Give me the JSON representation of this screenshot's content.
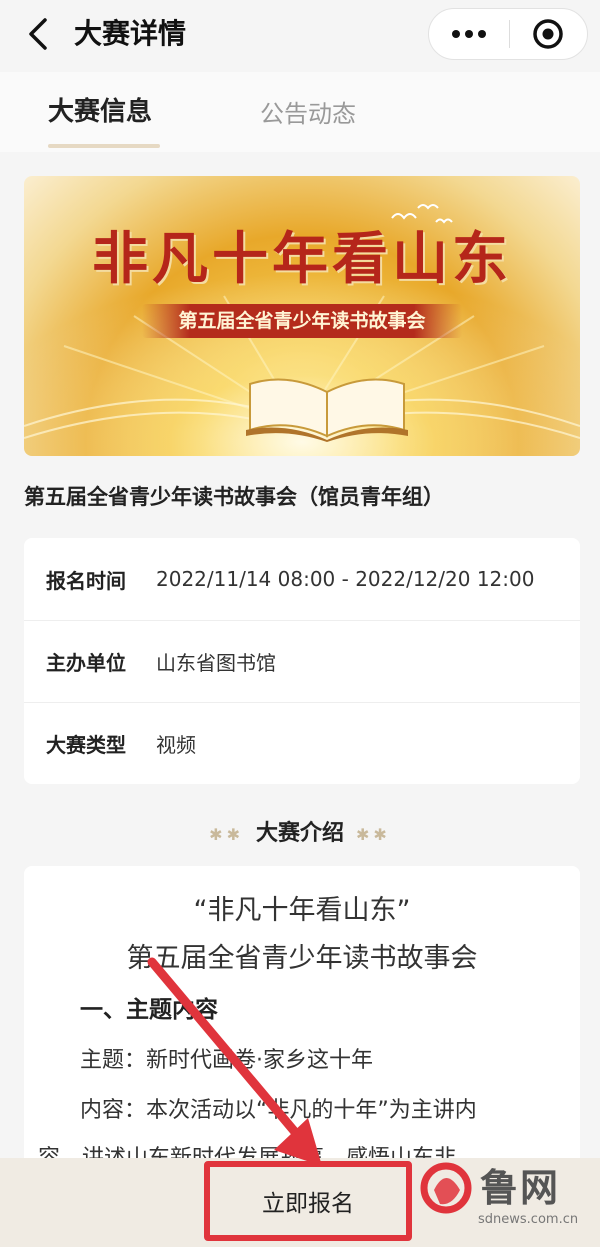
{
  "navbar": {
    "title": "大赛详情",
    "back_icon": "chevron-left-icon",
    "more_icon": "more-dots-icon",
    "close_icon": "target-circle-icon"
  },
  "tabs": [
    {
      "label": "大赛信息",
      "active": true
    },
    {
      "label": "公告动态",
      "active": false
    }
  ],
  "banner": {
    "title": "非凡十年看山东",
    "subtitle": "第五届全省青少年读书故事会"
  },
  "event": {
    "name": "第五届全省青少年读书故事会（馆员青年组）"
  },
  "info": [
    {
      "label": "报名时间",
      "value": "2022/11/14 08:00 - 2022/12/20 12:00"
    },
    {
      "label": "主办单位",
      "value": "山东省图书馆"
    },
    {
      "label": "大赛类型",
      "value": "视频"
    }
  ],
  "intro": {
    "heading": "大赛介绍",
    "deco": "✱✱",
    "title_line1": "“非凡十年看山东”",
    "title_line2": "第五届全省青少年读书故事会",
    "section1": "一、主题内容",
    "para1": "主题：新时代画卷·家乡这十年",
    "para2": "内容：本次活动以“非凡的十年”为主讲内",
    "para3": "容，讲述山东新时代发展故事，感悟山东非"
  },
  "bottom": {
    "signup_label": "立即报名"
  },
  "watermark": {
    "text": "鲁网",
    "url": "sdnews.com.cn"
  },
  "colors": {
    "accent_red": "#e0343c",
    "tab_underline": "#e6d9c3",
    "banner_red": "#b5261a"
  }
}
